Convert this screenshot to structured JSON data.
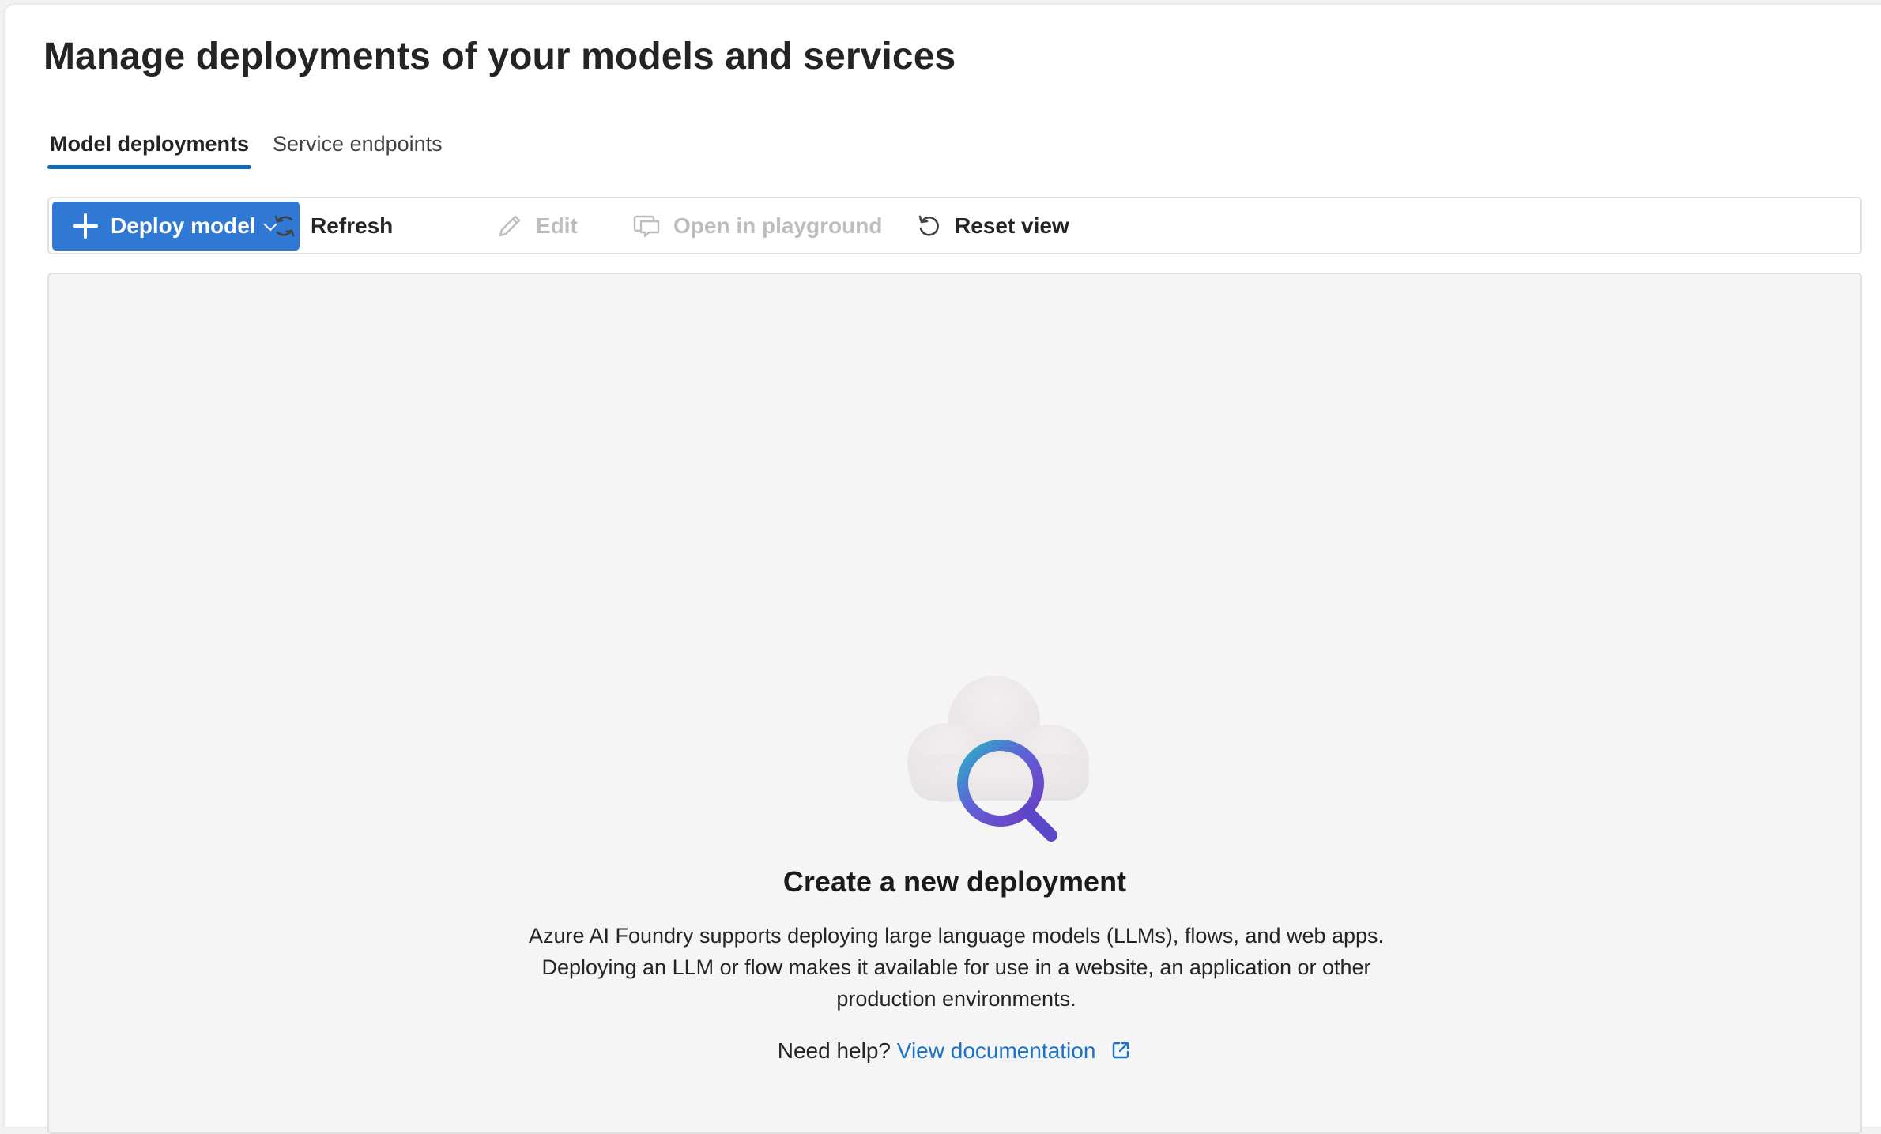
{
  "page": {
    "title": "Manage deployments of your models and services"
  },
  "tabs": [
    {
      "label": "Model deployments",
      "active": true
    },
    {
      "label": "Service endpoints",
      "active": false
    }
  ],
  "toolbar": {
    "deploy_label": "Deploy model",
    "refresh_label": "Refresh",
    "edit_label": "Edit",
    "playground_label": "Open in playground",
    "reset_label": "Reset view"
  },
  "empty_state": {
    "title": "Create a new deployment",
    "description": "Azure AI Foundry supports deploying large language models (LLMs), flows, and web apps. Deploying an LLM or flow makes it available for use in a website, an application or other production environments.",
    "help_prefix": "Need help?",
    "help_link": "View documentation"
  },
  "colors": {
    "accent": "#2f78d4",
    "link": "#1a73c9",
    "tab_indicator": "#0f6cbd",
    "disabled_text": "#bdbdbd"
  },
  "icons": {
    "deploy": "plus-icon",
    "deploy_menu": "chevron-down-icon",
    "refresh": "refresh-icon",
    "edit": "pencil-icon",
    "playground": "chat-window-icon",
    "reset": "reset-icon",
    "illustration": "cloud-search-icon",
    "external": "external-link-icon"
  }
}
